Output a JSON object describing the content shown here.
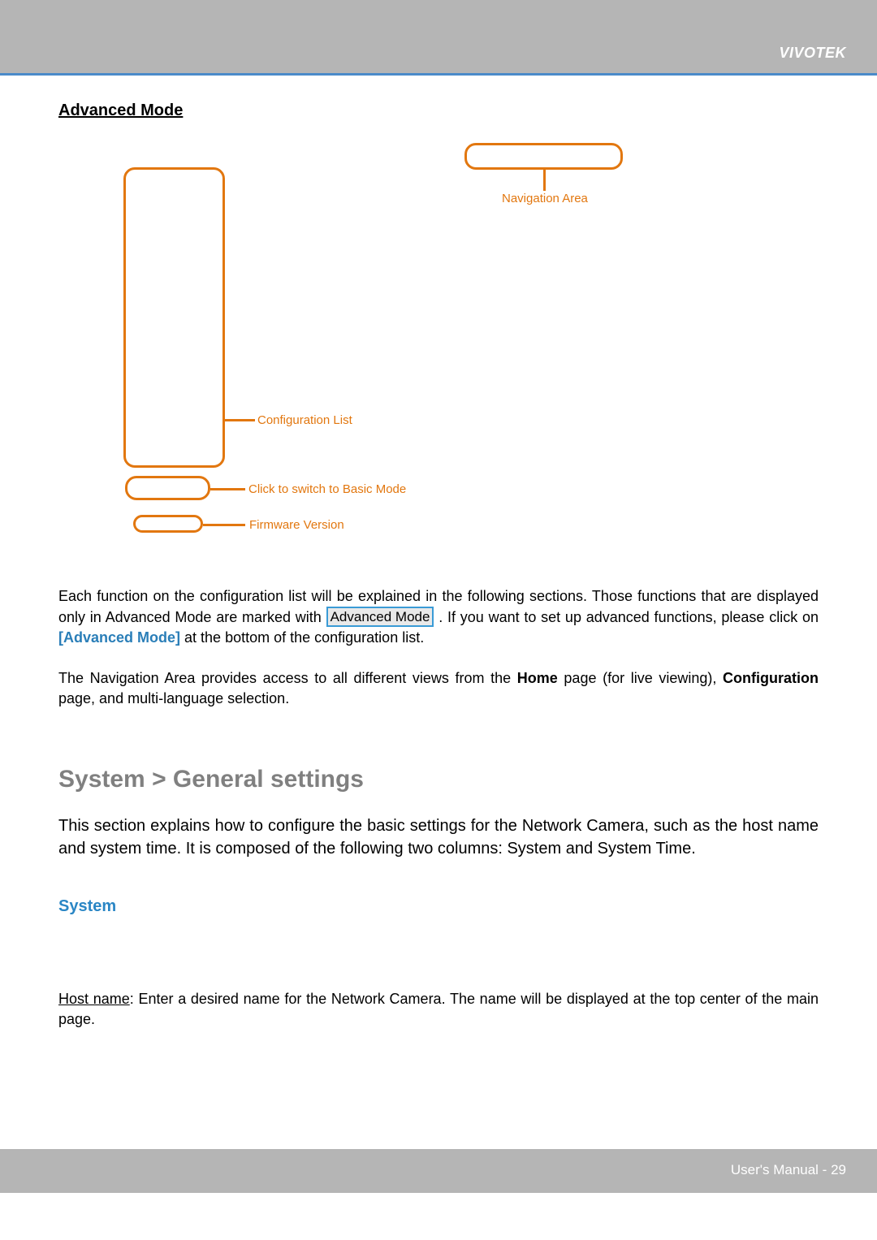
{
  "header": {
    "brand": "VIVOTEK"
  },
  "section": {
    "advancedModeHeading": "Advanced Mode"
  },
  "diagram": {
    "navArea": "Navigation Area",
    "configList": "Configuration List",
    "basicMode": "Click to switch to Basic Mode",
    "firmware": "Firmware Version"
  },
  "para1": {
    "a": "Each function on the configuration list will be explained in the following sections. Those functions that are displayed only in Advanced Mode are marked with ",
    "badge": "Advanced Mode",
    "b": ". If you want to set up advanced functions, please click on ",
    "link": "[Advanced Mode]",
    "c": " at the bottom of the configuration list."
  },
  "para2": {
    "a": "The Navigation Area provides access to all different views from the ",
    "home": "Home",
    "b": " page (for live viewing), ",
    "config": "Configuration",
    "c": " page, and multi-language selection."
  },
  "h2": "System > General settings",
  "intro": "This section explains how to configure the basic settings for the Network Camera, such as the host name and system time. It is composed of the following two columns: System and System Time.",
  "subHeading": "System",
  "hostname": {
    "label": "Host name",
    "text": ": Enter a desired name for the Network Camera. The name will be displayed at the top center of the main page."
  },
  "footer": {
    "label": "User's Manual - ",
    "page": "29"
  }
}
